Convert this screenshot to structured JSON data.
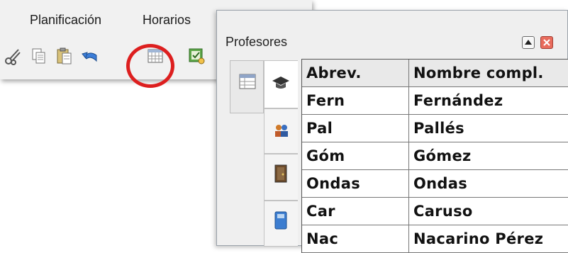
{
  "menu": {
    "items": [
      "Planificación",
      "Horarios"
    ]
  },
  "toolbar": {
    "icons": [
      "scissors-icon",
      "copy-icon",
      "paste-icon",
      "undo-icon",
      "timetable-icon",
      "checkmark-icon"
    ]
  },
  "window": {
    "title": "Profesores",
    "restore_icon": "triangle-up-icon",
    "close_icon": "close-icon"
  },
  "side_tabs": [
    "grid-icon",
    "teacher-cap-icon",
    "people-icon",
    "door-icon",
    "book-icon"
  ],
  "table": {
    "columns": [
      "Abrev.",
      "Nombre compl."
    ],
    "rows": [
      [
        "Fern",
        "Fernández"
      ],
      [
        "Pal",
        "Pallés"
      ],
      [
        "Góm",
        "Gómez"
      ],
      [
        "Ondas",
        "Ondas"
      ],
      [
        "Car",
        "Caruso"
      ],
      [
        "Nac",
        "Nacarino Pérez"
      ]
    ]
  },
  "colors": {
    "highlight_circle": "#dd1f1f",
    "close_button": "#e86b5c"
  }
}
